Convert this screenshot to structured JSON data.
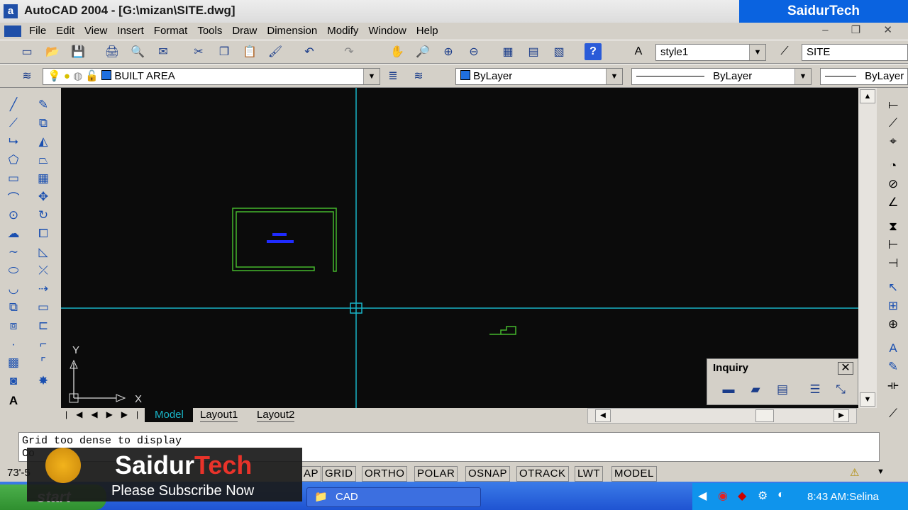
{
  "window": {
    "title": "AutoCAD 2004 - [G:\\mizan\\SITE.dwg]",
    "app_icon_label": "a"
  },
  "brand_label": "SaidurTech",
  "menu": [
    "File",
    "Edit",
    "View",
    "Insert",
    "Format",
    "Tools",
    "Draw",
    "Dimension",
    "Modify",
    "Window",
    "Help"
  ],
  "window_controls": "– ❐ ✕",
  "toolbar1": {
    "text_style": "style1",
    "dim_style": "SITE"
  },
  "toolbar2": {
    "layer": "BUILT AREA",
    "color": "ByLayer",
    "linetype": "ByLayer",
    "lineweight": "ByLayer"
  },
  "ucs": {
    "y_label": "Y",
    "x_label": "X"
  },
  "tabs": {
    "model": "Model",
    "layout1": "Layout1",
    "layout2": "Layout2"
  },
  "command_lines": [
    "Grid too dense to display",
    "Co"
  ],
  "status": {
    "coords": "73'-5",
    "buttons": [
      "AP",
      "GRID",
      "ORTHO",
      "POLAR",
      "OSNAP",
      "OTRACK",
      "LWT",
      "MODEL"
    ]
  },
  "inquiry": {
    "title": "Inquiry"
  },
  "taskbar": {
    "start_label": "start",
    "cad_label": "CAD",
    "clock": "8:43 AM:Selina"
  },
  "overlay": {
    "name_a": "Saidur",
    "name_b": "Tech",
    "subscribe": "Please Subscribe Now"
  },
  "colors": {
    "canvas": "#0b0b0b",
    "crosshair": "#19b5c8",
    "geometry": "#45b82c",
    "block": "#1f2bff",
    "title_accent": "#0a63e0"
  }
}
